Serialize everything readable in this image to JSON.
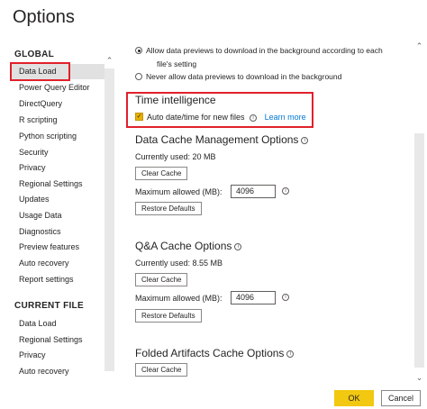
{
  "window": {
    "title": "Options"
  },
  "sidebar": {
    "global_heading": "GLOBAL",
    "global_items": [
      "Data Load",
      "Power Query Editor",
      "DirectQuery",
      "R scripting",
      "Python scripting",
      "Security",
      "Privacy",
      "Regional Settings",
      "Updates",
      "Usage Data",
      "Diagnostics",
      "Preview features",
      "Auto recovery",
      "Report settings"
    ],
    "current_heading": "CURRENT FILE",
    "current_items": [
      "Data Load",
      "Regional Settings",
      "Privacy",
      "Auto recovery"
    ],
    "selected": "Data Load"
  },
  "previews": {
    "option1_line1": "Allow data previews to download in the background according to each",
    "option1_line2": "file's setting",
    "option2": "Never allow data previews to download in the background"
  },
  "time_intelligence": {
    "title": "Time intelligence",
    "checkbox_label": "Auto date/time for new files",
    "checked": true,
    "learn_more": "Learn more"
  },
  "data_cache": {
    "title": "Data Cache Management Options",
    "current_usage": "Currently used: 20 MB",
    "clear_label": "Clear Cache",
    "max_label": "Maximum allowed (MB):",
    "max_value": "4096",
    "restore_label": "Restore Defaults"
  },
  "qa_cache": {
    "title": "Q&A Cache Options",
    "current_usage": "Currently used: 8.55 MB",
    "clear_label": "Clear Cache",
    "max_label": "Maximum allowed (MB):",
    "max_value": "4096",
    "restore_label": "Restore Defaults"
  },
  "folded_cache": {
    "title": "Folded Artifacts Cache Options",
    "clear_label": "Clear Cache"
  },
  "footer": {
    "ok_label": "OK",
    "cancel_label": "Cancel"
  },
  "colors": {
    "accent": "#f2c811",
    "highlight": "#e0212b",
    "link": "#0078d4"
  }
}
